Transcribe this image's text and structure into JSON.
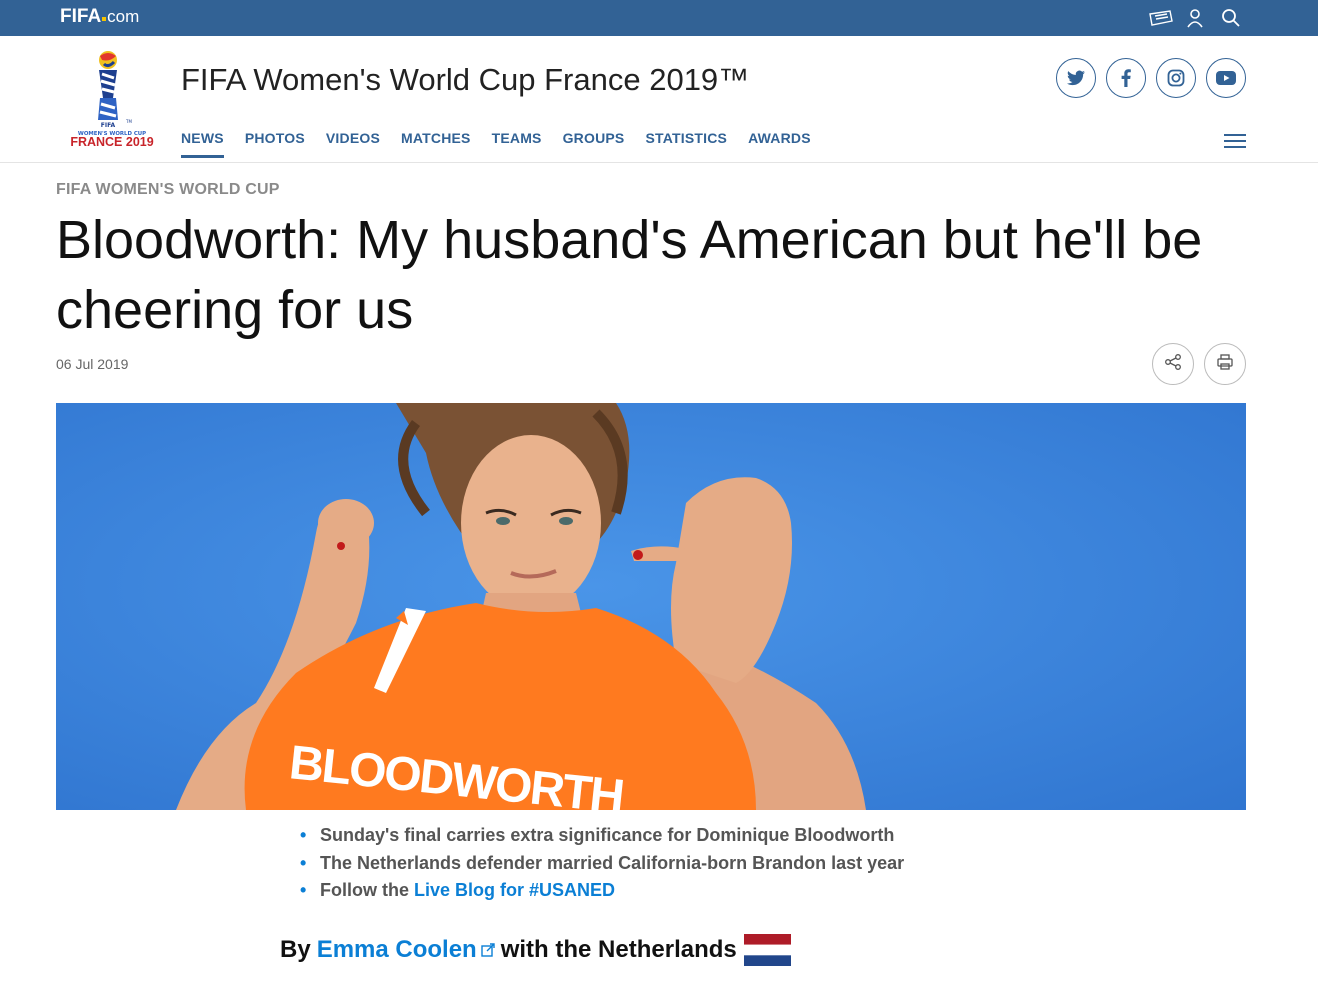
{
  "topbar": {
    "logo_text": "FIFA",
    "logo_suffix": "com",
    "icons": [
      "ticket-icon",
      "user-icon",
      "search-icon"
    ]
  },
  "header": {
    "logo_caption_small": "WOMEN'S WORLD CUP",
    "logo_caption": "FRANCE 2019",
    "site_title": "FIFA Women's World Cup France 2019™",
    "socials": [
      "twitter-icon",
      "facebook-icon",
      "instagram-icon",
      "youtube-icon"
    ],
    "nav": [
      "NEWS",
      "PHOTOS",
      "VIDEOS",
      "MATCHES",
      "TEAMS",
      "GROUPS",
      "STATISTICS",
      "AWARDS"
    ],
    "active_nav": "NEWS"
  },
  "article": {
    "kicker": "FIFA WOMEN'S WORLD CUP",
    "headline": "Bloodworth: My husband's American but he'll be cheering for us",
    "date": "06 Jul 2019",
    "hero_jersey_text": "BLOODWORTH",
    "bullets": [
      "Sunday's final carries extra significance for Dominique Bloodworth",
      "The Netherlands defender married California-born Brandon last year"
    ],
    "bullet_link_prefix": "Follow the",
    "bullet_link_text": "Live Blog for #USANED",
    "byline_prefix": "By",
    "byline_author": "Emma Coolen",
    "byline_suffix": "with the Netherlands"
  },
  "colors": {
    "topbar": "#326295",
    "link": "#0b7fd5",
    "hero_bg": "#3e86dd",
    "jersey": "#ff7a1f"
  }
}
